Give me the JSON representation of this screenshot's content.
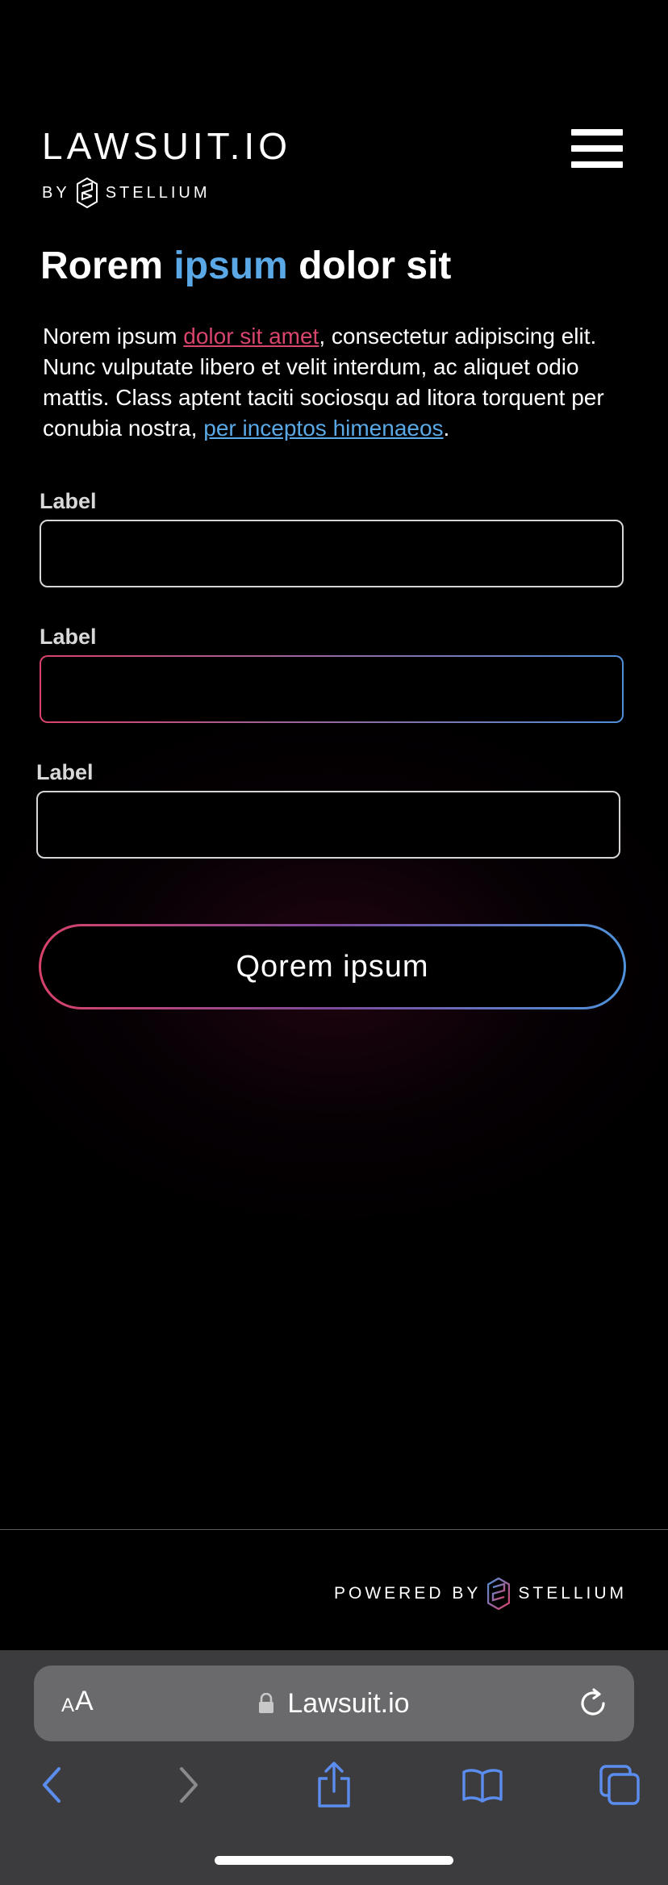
{
  "brand": {
    "title": "LAWSUIT.IO",
    "by": "BY",
    "company": "STELLIUM"
  },
  "headline": {
    "word1": "Rorem ",
    "accent": "ipsum",
    "word2": " dolor sit"
  },
  "intro": {
    "part1": "Norem ipsum ",
    "link1": "dolor sit amet",
    "part2": ", consectetur adipiscing elit. Nunc vulputate libero et velit interdum, ac aliquet odio mattis. Class aptent taciti sociosqu ad litora torquent per conubia nostra, ",
    "link2": "per inceptos himenaeos",
    "part3": "."
  },
  "form": {
    "fields": [
      {
        "label": "Label",
        "value": ""
      },
      {
        "label": "Label",
        "value": ""
      },
      {
        "label": "Label",
        "value": ""
      }
    ],
    "submit_label": "Qorem ipsum"
  },
  "footer": {
    "powered_by": "POWERED BY",
    "company": "STELLIUM"
  },
  "browser": {
    "aa_small": "A",
    "aa_big": "A",
    "url": "Lawsuit.io"
  },
  "colors": {
    "accent_blue": "#5aa9e6",
    "accent_pink": "#d7456c",
    "ios_blue": "#5b8def"
  }
}
